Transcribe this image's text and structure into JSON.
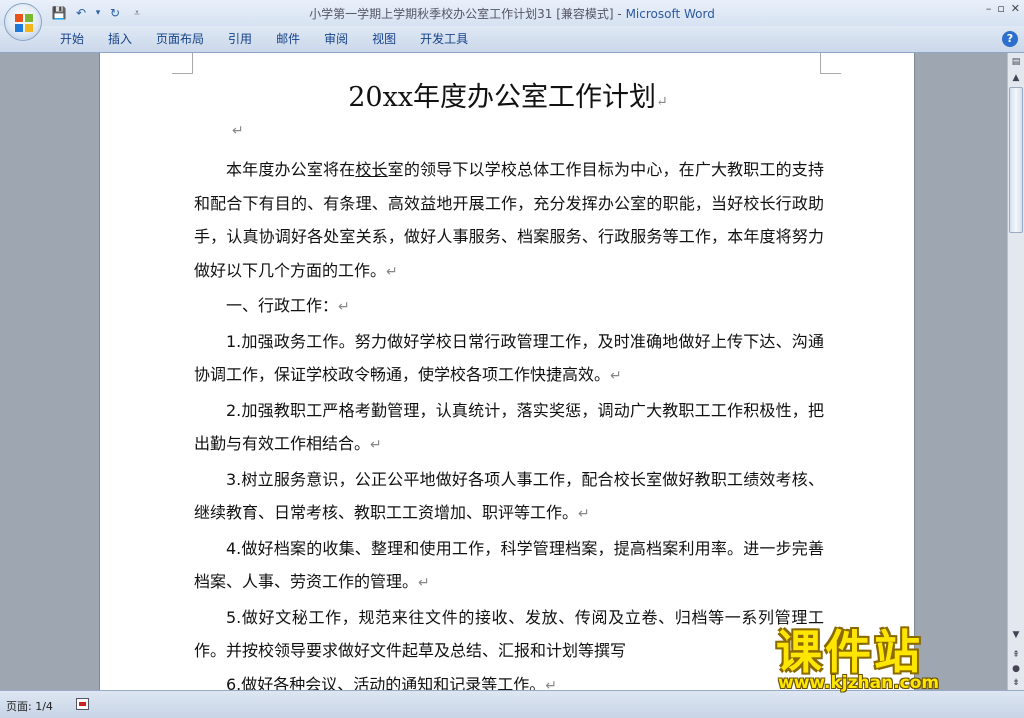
{
  "window": {
    "title": "小学第一学期上学期秋季校办公室工作计划31 [兼容模式]",
    "title_separator": " - ",
    "app_name": "Microsoft Word",
    "controls": [
      "–",
      "▫",
      "✕"
    ]
  },
  "qat": {
    "save_icon": "💾",
    "undo_icon": "↶",
    "dropdown_icon": "▾",
    "redo_icon": "↻",
    "customize_icon": "⩡"
  },
  "ribbon": {
    "tabs": [
      "开始",
      "插入",
      "页面布局",
      "引用",
      "邮件",
      "审阅",
      "视图",
      "开发工具"
    ],
    "help_icon": "?"
  },
  "document": {
    "heading": "20xx年度办公室工作计划",
    "para_mark": "↵",
    "intro_before": "本年度办公室将在",
    "intro_underlined": "校长",
    "intro_after": "室的领导下以学校总体工作目标为中心，在广大教职工的支持和配合下有目的、有条理、高效益地开展工作，充分发挥办公室的职能，当好校长行政助手，认真协调好各处室关系，做好人事服务、档案服务、行政服务等工作，本年度将努力做好以下几个方面的工作。",
    "section1": "一、行政工作：",
    "items": [
      "1.加强政务工作。努力做好学校日常行政管理工作，及时准确地做好上传下达、沟通协调工作，保证学校政令畅通，使学校各项工作快捷高效。",
      "2.加强教职工严格考勤管理，认真统计，落实奖惩，调动广大教职工工作积极性，把出勤与有效工作相结合。",
      "3.树立服务意识，公正公平地做好各项人事工作，配合校长室做好教职工绩效考核、继续教育、日常考核、教职工工资增加、职评等工作。",
      "4.做好档案的收集、整理和使用工作，科学管理档案，提高档案利用率。进一步完善档案、人事、劳资工作的管理。",
      "5.做好文秘工作，规范来往文件的接收、发放、传阅及立卷、归档等一系列管理工作。并按校领导要求做好文件起草及总结、汇报和计划等撰写",
      "6.做好各种会议、活动的通知和记录等工作。"
    ]
  },
  "scrollbar": {
    "ruler_icon": "▤",
    "up_icon": "▲",
    "down_icon": "▼",
    "prev_icon": "⇞",
    "browse_icon": "●",
    "next_icon": "⇟"
  },
  "status": {
    "page": "页面: 1/4"
  },
  "watermark": {
    "logo": "课件站",
    "url": "www.kjzhan.com"
  },
  "colors": {
    "app_name": "#2c5aa0",
    "tab_text": "#15428b",
    "workspace": "#9ea6b1",
    "watermark": "#ffe600"
  }
}
